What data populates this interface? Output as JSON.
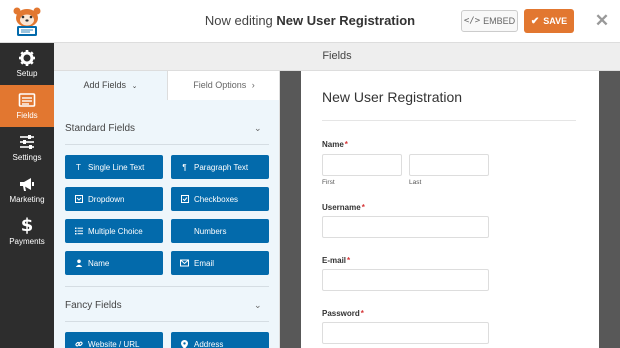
{
  "header": {
    "editing_prefix": "Now editing",
    "form_name": "New User Registration",
    "embed_label": "EMBED",
    "save_label": "SAVE",
    "close_icon": "close-icon",
    "accent": "#e27730"
  },
  "sidebar": {
    "items": [
      {
        "label": "Setup",
        "icon": "gear-icon"
      },
      {
        "label": "Fields",
        "icon": "fields-icon",
        "active": true
      },
      {
        "label": "Settings",
        "icon": "sliders-icon"
      },
      {
        "label": "Marketing",
        "icon": "megaphone-icon"
      },
      {
        "label": "Payments",
        "icon": "dollar-icon"
      }
    ]
  },
  "band": {
    "title": "Fields"
  },
  "panel": {
    "tabs": {
      "add": "Add Fields",
      "options": "Field Options"
    },
    "standard_title": "Standard Fields",
    "fancy_title": "Fancy Fields",
    "standard_fields": [
      {
        "label": "Single Line Text",
        "icon": "text-icon"
      },
      {
        "label": "Paragraph Text",
        "icon": "paragraph-icon"
      },
      {
        "label": "Dropdown",
        "icon": "dropdown-icon"
      },
      {
        "label": "Checkboxes",
        "icon": "checkbox-icon"
      },
      {
        "label": "Multiple Choice",
        "icon": "list-icon"
      },
      {
        "label": "Numbers",
        "icon": ""
      },
      {
        "label": "Name",
        "icon": "user-icon"
      },
      {
        "label": "Email",
        "icon": "envelope-icon"
      }
    ],
    "fancy_fields": [
      {
        "label": "Website / URL",
        "icon": "link-icon"
      },
      {
        "label": "Address",
        "icon": "map-marker-icon"
      }
    ]
  },
  "form": {
    "title": "New User Registration",
    "fields": {
      "name": {
        "label": "Name",
        "required": "*",
        "first": "First",
        "last": "Last"
      },
      "username": {
        "label": "Username",
        "required": "*"
      },
      "email": {
        "label": "E-mail",
        "required": "*"
      },
      "password": {
        "label": "Password",
        "required": "*"
      }
    }
  }
}
